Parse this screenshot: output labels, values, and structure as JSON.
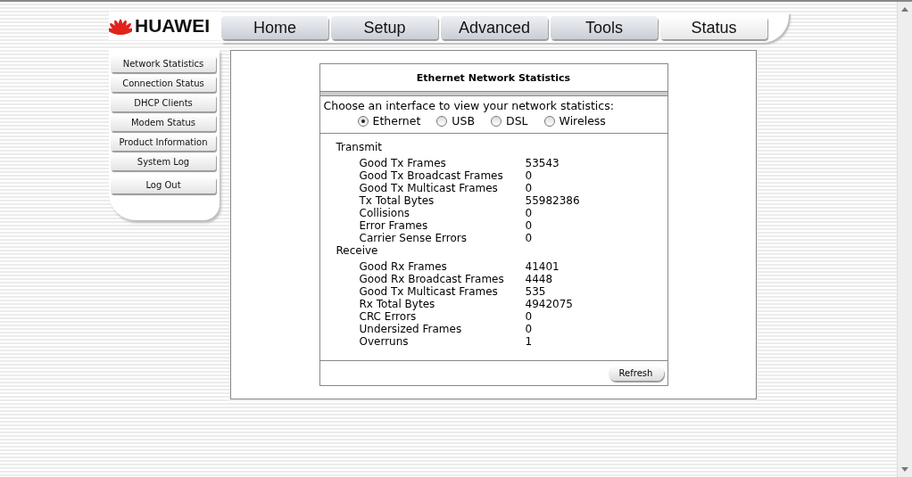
{
  "brand": "HUAWEI",
  "tabs": [
    {
      "label": "Home",
      "selected": false
    },
    {
      "label": "Setup",
      "selected": false
    },
    {
      "label": "Advanced",
      "selected": false
    },
    {
      "label": "Tools",
      "selected": false
    },
    {
      "label": "Status",
      "selected": true
    }
  ],
  "sidebar": {
    "items": [
      {
        "label": "Network Statistics"
      },
      {
        "label": "Connection Status"
      },
      {
        "label": "DHCP Clients"
      },
      {
        "label": "Modem Status"
      },
      {
        "label": "Product Information"
      },
      {
        "label": "System Log"
      }
    ],
    "logout": "Log Out"
  },
  "panel": {
    "title": "Ethernet Network Statistics",
    "prompt": "Choose an interface to view your network statistics:",
    "interfaces": [
      {
        "label": "Ethernet",
        "selected": true
      },
      {
        "label": "USB",
        "selected": false
      },
      {
        "label": "DSL",
        "selected": false
      },
      {
        "label": "Wireless",
        "selected": false
      }
    ],
    "sections": [
      {
        "title": "Transmit",
        "rows": [
          {
            "label": "Good Tx Frames",
            "value": "53543"
          },
          {
            "label": "Good Tx Broadcast Frames",
            "value": "0"
          },
          {
            "label": "Good Tx Multicast Frames",
            "value": "0"
          },
          {
            "label": "Tx Total Bytes",
            "value": "55982386"
          },
          {
            "label": "Collisions",
            "value": "0"
          },
          {
            "label": "Error Frames",
            "value": "0"
          },
          {
            "label": "Carrier Sense Errors",
            "value": "0"
          }
        ]
      },
      {
        "title": "Receive",
        "rows": [
          {
            "label": "Good Rx Frames",
            "value": "41401"
          },
          {
            "label": "Good Rx Broadcast Frames",
            "value": "4448"
          },
          {
            "label": "Good Tx Multicast Frames",
            "value": "535"
          },
          {
            "label": "Rx Total Bytes",
            "value": "4942075"
          },
          {
            "label": "CRC Errors",
            "value": "0"
          },
          {
            "label": "Undersized Frames",
            "value": "0"
          },
          {
            "label": "Overruns",
            "value": "1"
          }
        ]
      }
    ],
    "refresh": "Refresh"
  }
}
